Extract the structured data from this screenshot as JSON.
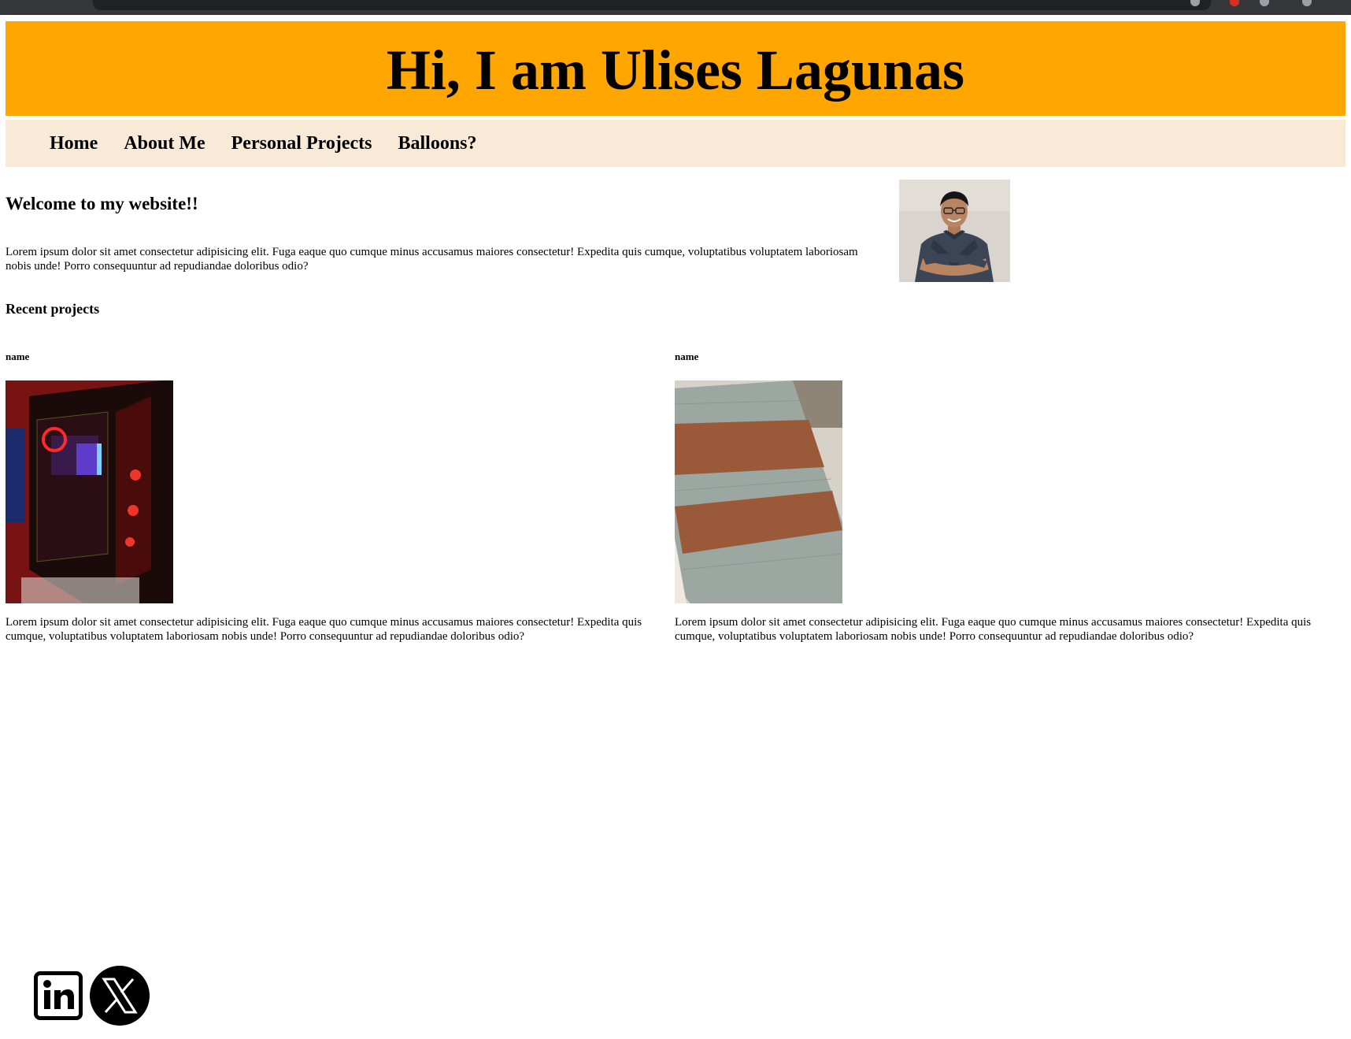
{
  "header": {
    "title": "Hi, I am Ulises Lagunas"
  },
  "nav": {
    "items": [
      {
        "label": "Home"
      },
      {
        "label": "About Me"
      },
      {
        "label": "Personal Projects"
      },
      {
        "label": "Balloons?"
      }
    ]
  },
  "intro": {
    "heading": "Welcome to my website!!",
    "text": "Lorem ipsum dolor sit amet consectetur adipisicing elit. Fuga eaque quo cumque minus accusamus maiores consectetur! Expedita quis cumque, voluptatibus voluptatem laboriosam nobis unde! Porro consequuntur ad repudiandae doloribus odio?"
  },
  "recent": {
    "heading": "Recent projects",
    "projects": [
      {
        "name": "name",
        "description": "Lorem ipsum dolor sit amet consectetur adipisicing elit. Fuga eaque quo cumque minus accusamus maiores consectetur! Expedita quis cumque, voluptatibus voluptatem laboriosam nobis unde! Porro consequuntur ad repudiandae doloribus odio?"
      },
      {
        "name": "name",
        "description": "Lorem ipsum dolor sit amet consectetur adipisicing elit. Fuga eaque quo cumque minus accusamus maiores consectetur! Expedita quis cumque, voluptatibus voluptatem laboriosam nobis unde! Porro consequuntur ad repudiandae doloribus odio?"
      }
    ]
  },
  "footer": {
    "icons": [
      "linkedin-icon",
      "x-icon"
    ]
  },
  "colors": {
    "header_bg": "#ffa600",
    "nav_bg": "#f9ead7"
  }
}
